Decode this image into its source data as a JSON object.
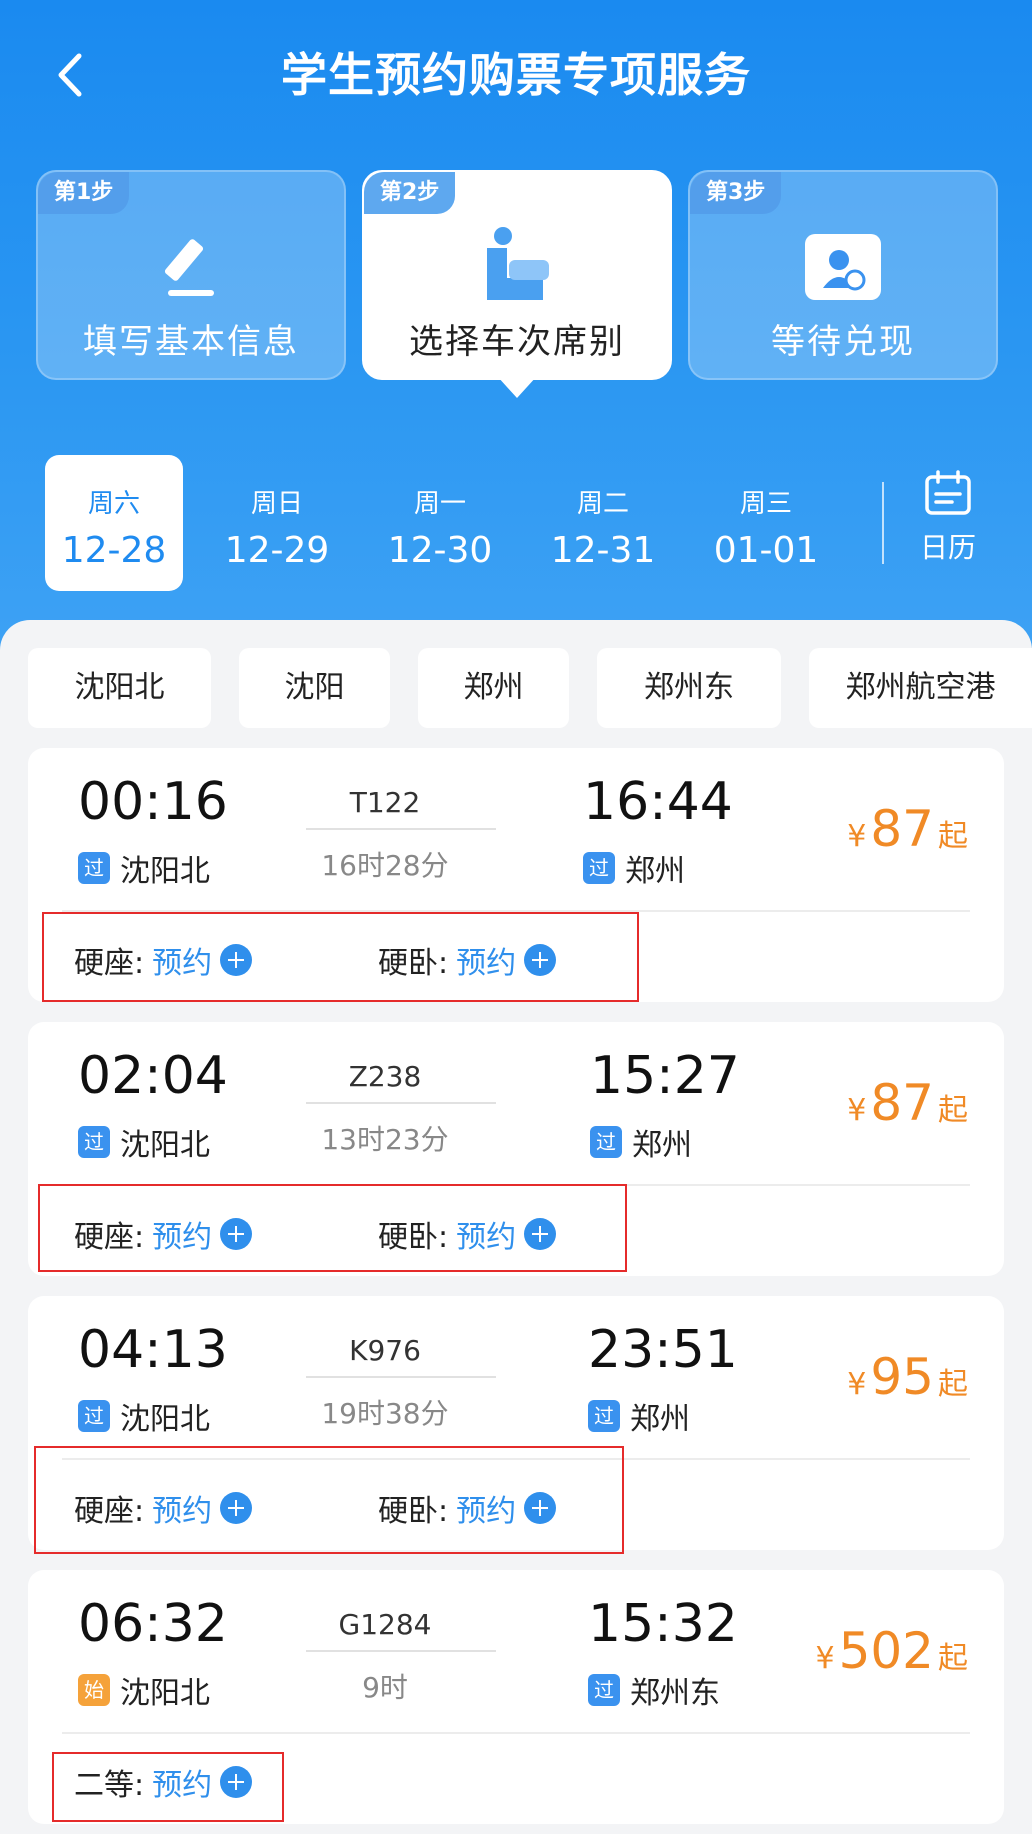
{
  "header": {
    "title": "学生预约购票专项服务"
  },
  "steps": [
    {
      "tag": "第1步",
      "label": "填写基本信息",
      "icon": "pencil-icon"
    },
    {
      "tag": "第2步",
      "label": "选择车次席别",
      "icon": "seat-icon"
    },
    {
      "tag": "第3步",
      "label": "等待兑现",
      "icon": "ticket-icon"
    }
  ],
  "dates": [
    {
      "dow": "周六",
      "day": "12-28"
    },
    {
      "dow": "周日",
      "day": "12-29"
    },
    {
      "dow": "周一",
      "day": "12-30"
    },
    {
      "dow": "周二",
      "day": "12-31"
    },
    {
      "dow": "周三",
      "day": "01-01"
    }
  ],
  "calendar": {
    "label": "日历"
  },
  "stations": [
    "沈阳北",
    "沈阳",
    "郑州",
    "郑州东",
    "郑州航空港"
  ],
  "trains": [
    {
      "dep_time": "00:16",
      "arr_time": "16:44",
      "number": "T122",
      "duration": "16时28分",
      "from_badge": "过",
      "from": "沈阳北",
      "to_badge": "过",
      "to": "郑州",
      "price": "87",
      "seats": [
        {
          "type": "硬座:",
          "action": "预约"
        },
        {
          "type": "硬卧:",
          "action": "预约"
        }
      ]
    },
    {
      "dep_time": "02:04",
      "arr_time": "15:27",
      "number": "Z238",
      "duration": "13时23分",
      "from_badge": "过",
      "from": "沈阳北",
      "to_badge": "过",
      "to": "郑州",
      "price": "87",
      "seats": [
        {
          "type": "硬座:",
          "action": "预约"
        },
        {
          "type": "硬卧:",
          "action": "预约"
        }
      ]
    },
    {
      "dep_time": "04:13",
      "arr_time": "23:51",
      "number": "K976",
      "duration": "19时38分",
      "from_badge": "过",
      "from": "沈阳北",
      "to_badge": "过",
      "to": "郑州",
      "price": "95",
      "seats": [
        {
          "type": "硬座:",
          "action": "预约"
        },
        {
          "type": "硬卧:",
          "action": "预约"
        }
      ]
    },
    {
      "dep_time": "06:32",
      "arr_time": "15:32",
      "number": "G1284",
      "duration": "9时",
      "from_badge": "始",
      "from": "沈阳北",
      "to_badge": "过",
      "to": "郑州东",
      "price": "502",
      "seats": [
        {
          "type": "二等:",
          "action": "预约"
        }
      ]
    }
  ],
  "currency": "¥",
  "price_suffix": "起",
  "colors": {
    "primary": "#1f8bf0",
    "price": "#f08a26",
    "highlight_box": "#e52b2b",
    "start_badge": "#f5a23a"
  }
}
